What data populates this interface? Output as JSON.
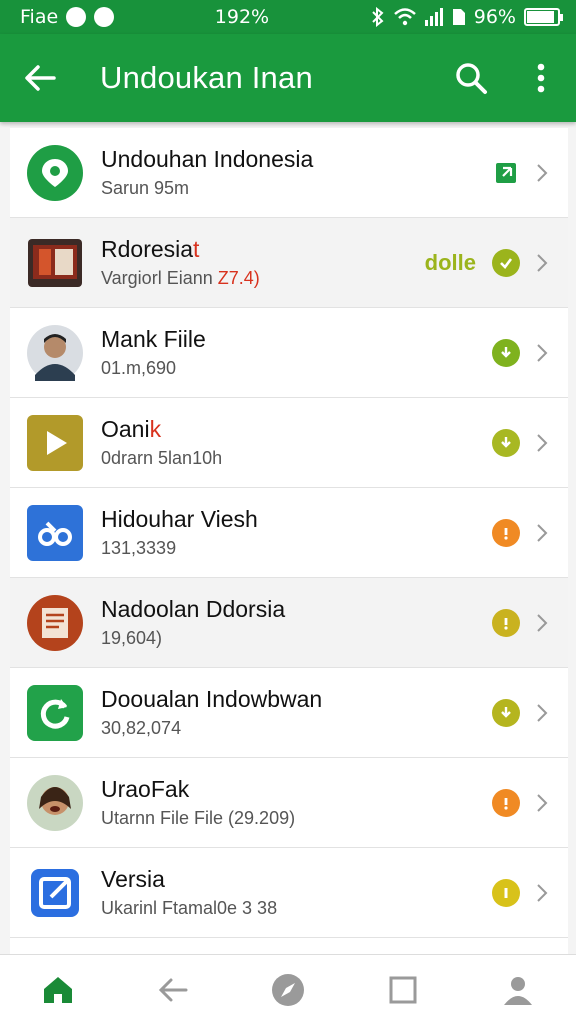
{
  "status_bar": {
    "carrier": "Fiae",
    "center_text": "192%",
    "battery_text": "96%",
    "battery_level": 0.9,
    "icons": [
      "notification-icon",
      "clock-icon",
      "bluetooth-icon",
      "wifi-icon",
      "signal-icon",
      "sim-icon",
      "battery-icon"
    ]
  },
  "app_bar": {
    "title": "Undoukan Inan",
    "back_icon": "arrow-left-icon",
    "search_icon": "search-icon",
    "menu_icon": "more-vert-icon"
  },
  "list": {
    "items": [
      {
        "title": "Undouhan Indonesia",
        "subtitle": "Sarun 95m",
        "title_suffix": "",
        "tag": "",
        "icon": "map-pin-icon",
        "icon_color": "#1f9e45",
        "status_icon": "open-external-icon",
        "status_color": "#1f9e45"
      },
      {
        "title": "Rdoresia",
        "subtitle": "Vargiorl Eiann ",
        "subtitle_suffix": "Z7.4)",
        "title_suffix": "t",
        "tag": "dolle",
        "icon": "photo-thumbnail-icon",
        "icon_color": "#8b2b1c",
        "status_icon": "download-check-icon",
        "status_color": "#9bb41c"
      },
      {
        "title": "Mank Fiile",
        "subtitle": "01.m,690",
        "title_suffix": "",
        "tag": "",
        "icon": "profile-photo-icon",
        "icon_color": "#3a4a5a",
        "status_icon": "download-icon",
        "status_color": "#7fb21e"
      },
      {
        "title": "Oani",
        "subtitle": "0drarn 5lan10h",
        "title_suffix": "k",
        "tag": "",
        "icon": "play-icon",
        "icon_color": "#b29a2a",
        "status_icon": "download-icon",
        "status_color": "#a8b823"
      },
      {
        "title": "Hidouhar Viesh",
        "subtitle": "131,3339",
        "title_suffix": "",
        "tag": "",
        "icon": "app-logo-icon",
        "icon_color": "#2e72d8",
        "status_icon": "alert-icon",
        "status_color": "#f08a24"
      },
      {
        "title": "Nadoolan Ddorsia",
        "subtitle": "19,604)",
        "title_suffix": "",
        "tag": "",
        "icon": "document-icon",
        "icon_color": "#b4431c",
        "status_icon": "alert-icon",
        "status_color": "#c9b21f"
      },
      {
        "title": "Dooualan Indowbwan",
        "subtitle": "30,82,074",
        "title_suffix": "",
        "tag": "",
        "icon": "refresh-icon",
        "icon_color": "#22a24a",
        "status_icon": "download-icon",
        "status_color": "#b5b51f"
      },
      {
        "title": "UraoFak",
        "subtitle": "Utarnn File File (29.209)",
        "title_suffix": "",
        "tag": "",
        "icon": "profile-photo-icon",
        "icon_color": "#6a4c3a",
        "status_icon": "alert-icon",
        "status_color": "#f08a24"
      },
      {
        "title": "Versia",
        "subtitle": "Ukarinl Ftamal0e 3 38",
        "title_suffix": "",
        "tag": "",
        "icon": "edit-icon",
        "icon_color": "#2b6ee0",
        "status_icon": "info-icon",
        "status_color": "#d8c21a"
      }
    ]
  },
  "bottom_nav": {
    "items": [
      {
        "name": "home",
        "icon": "home-icon",
        "active": true
      },
      {
        "name": "back",
        "icon": "arrow-left-icon",
        "active": false
      },
      {
        "name": "discover",
        "icon": "compass-icon",
        "active": false
      },
      {
        "name": "tabs",
        "icon": "square-icon",
        "active": false
      },
      {
        "name": "profile",
        "icon": "person-icon",
        "active": false
      }
    ]
  },
  "colors": {
    "primary": "#1a9a3e",
    "status_bar": "#18923b",
    "accent_red": "#d8321e",
    "nav_active": "#1a8a37",
    "nav_inactive": "#9a9a9a"
  }
}
